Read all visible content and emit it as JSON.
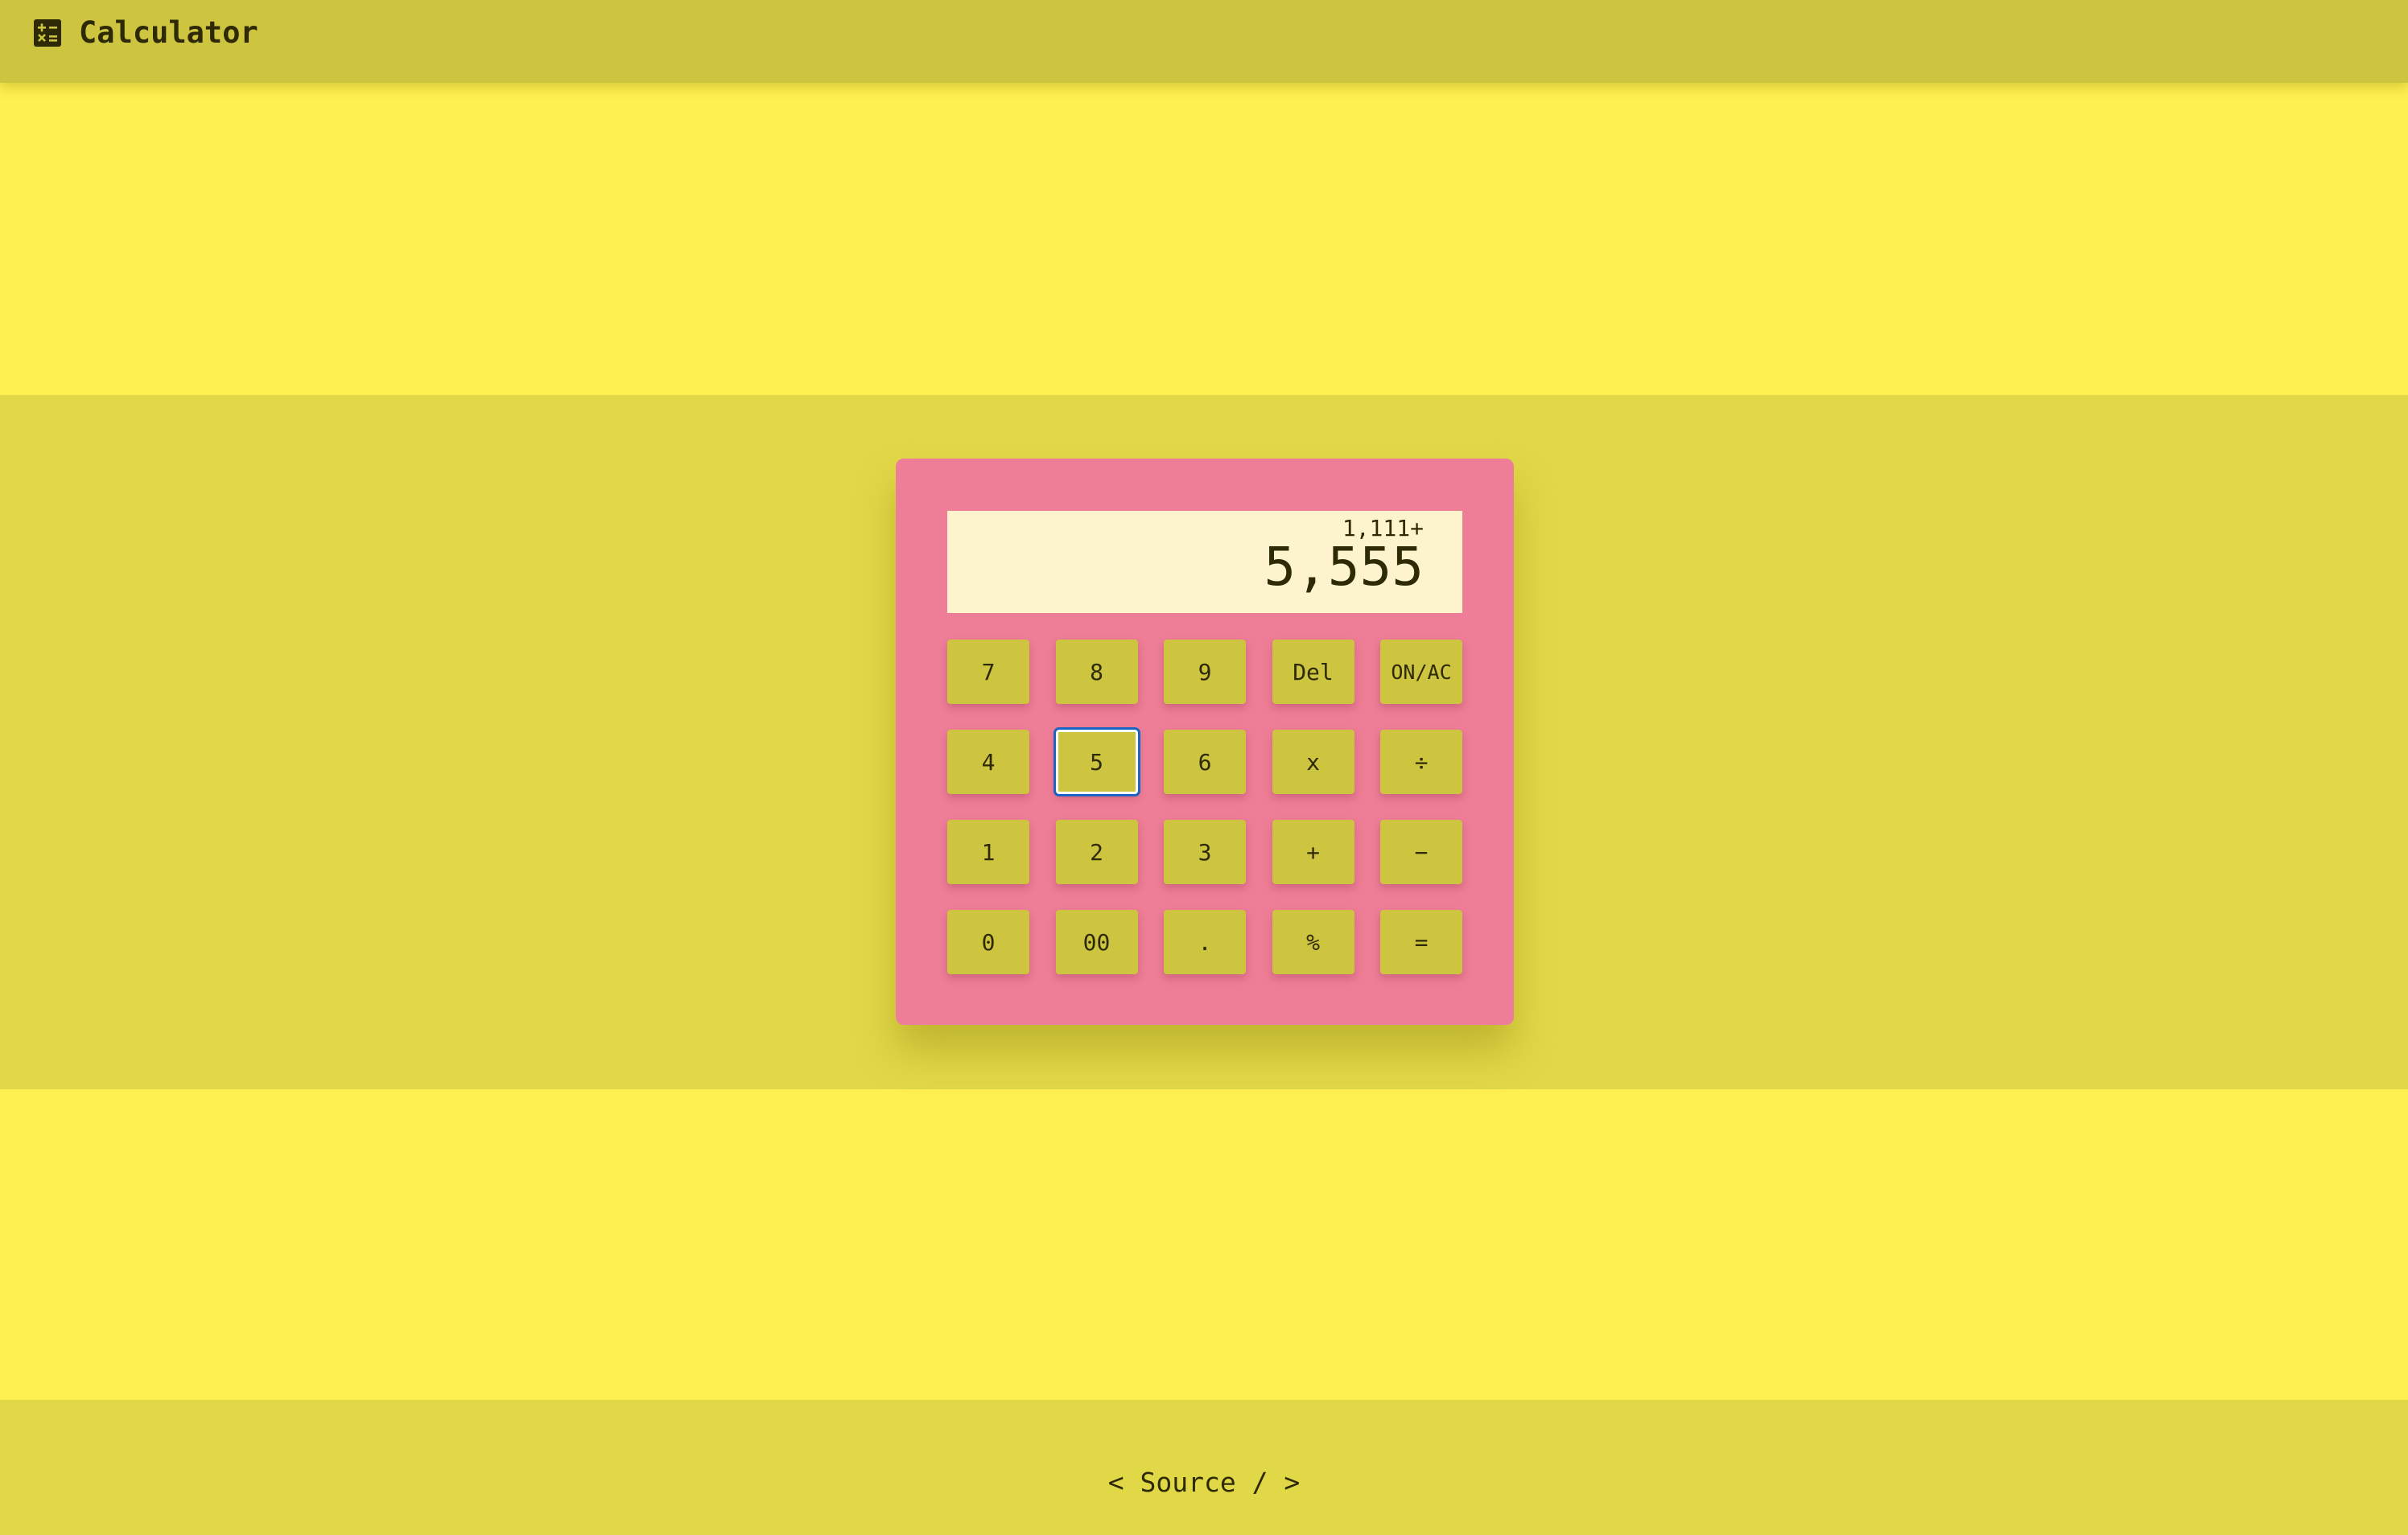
{
  "header": {
    "title": "Calculator",
    "icon": "calculator-icon"
  },
  "display": {
    "expression": "1,111+",
    "value": "5,555"
  },
  "keypad": {
    "rows": [
      [
        "7",
        "8",
        "9",
        "Del",
        "ON/AC"
      ],
      [
        "4",
        "5",
        "6",
        "x",
        "÷"
      ],
      [
        "1",
        "2",
        "3",
        "+",
        "−"
      ],
      [
        "0",
        "00",
        ".",
        "%",
        "="
      ]
    ],
    "focused_key": "5"
  },
  "footer": {
    "link_label": "< Source / >"
  },
  "colors": {
    "page_background": "#fff051",
    "band": "#e1d848",
    "header": "#cdc43f",
    "calculator_body": "#ee7d97",
    "display_background": "#fdf4cd",
    "key": "#cdc43f",
    "focus_ring": "#1a64c4",
    "text": "#2f2a06"
  }
}
